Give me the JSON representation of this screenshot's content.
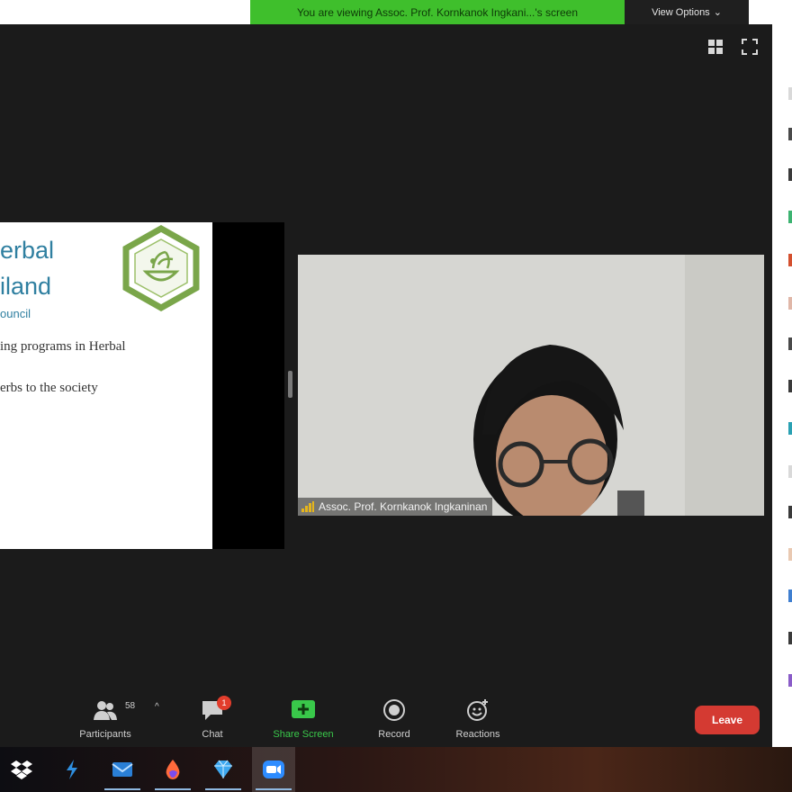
{
  "banner": {
    "viewing_text": "You are viewing Assoc. Prof. Kornkanok Ingkani...'s screen",
    "view_options_label": "View Options",
    "view_options_caret": "⌄"
  },
  "slide": {
    "title_line_1": "erbal",
    "title_line_2": "iland",
    "subtitle": "ouncil",
    "body_line_1": "ing programs in Herbal",
    "body_line_2": "erbs to the society"
  },
  "video": {
    "speaker_name": "Assoc. Prof. Kornkanok Ingkaninan"
  },
  "toolbar": {
    "participants_label": "Participants",
    "participants_count": "58",
    "participants_caret": "^",
    "chat_label": "Chat",
    "chat_badge": "1",
    "share_label": "Share Screen",
    "record_label": "Record",
    "reactions_label": "Reactions",
    "leave_label": "Leave"
  },
  "colors": {
    "banner_green": "#3fbf2c",
    "share_green": "#39c84a",
    "leave_red": "#d43a32",
    "slide_blue": "#2f7fa0",
    "logo_green": "#7aa64a"
  },
  "icons": {
    "top_right": [
      "grid-view-icon",
      "fullscreen-icon"
    ],
    "toolbar": [
      "participants-icon",
      "chat-icon",
      "share-screen-icon",
      "record-icon",
      "reactions-icon"
    ],
    "taskbar": [
      "dropbox-icon",
      "visual-studio-icon",
      "mail-icon",
      "paint-drop-icon",
      "gem-icon",
      "zoom-icon"
    ]
  }
}
